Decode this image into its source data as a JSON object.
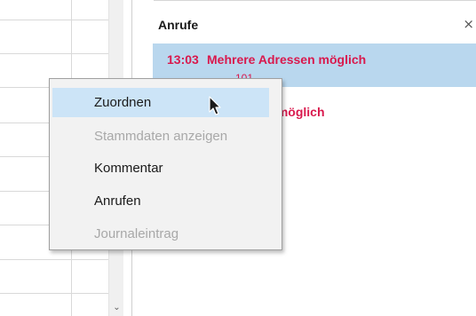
{
  "panel": {
    "title": "Anrufe",
    "close_glyph": "×",
    "calls": [
      {
        "time": "13:03",
        "name": "Mehrere Adressen möglich",
        "number": "101"
      },
      {
        "name_partial": "e Adressen möglich"
      }
    ]
  },
  "context_menu": {
    "items": [
      {
        "label": "Zuordnen",
        "enabled": true,
        "highlighted": true
      },
      {
        "label": "Stammdaten anzeigen",
        "enabled": false
      },
      {
        "label": "Kommentar",
        "enabled": true
      },
      {
        "label": "Anrufen",
        "enabled": true
      },
      {
        "label": "Journaleintrag",
        "enabled": false
      }
    ]
  },
  "scrollbar": {
    "down_glyph": "⌄"
  },
  "colors": {
    "accent_call": "#d9194d",
    "selection": "#b9d7ee",
    "menu_hover": "#cce4f7",
    "menu_bg": "#f2f2f2",
    "disabled_text": "#a8a8a8"
  },
  "icons": {
    "cursor": "arrow-cursor-icon",
    "close": "close-icon",
    "scroll_down": "chevron-down-icon"
  }
}
